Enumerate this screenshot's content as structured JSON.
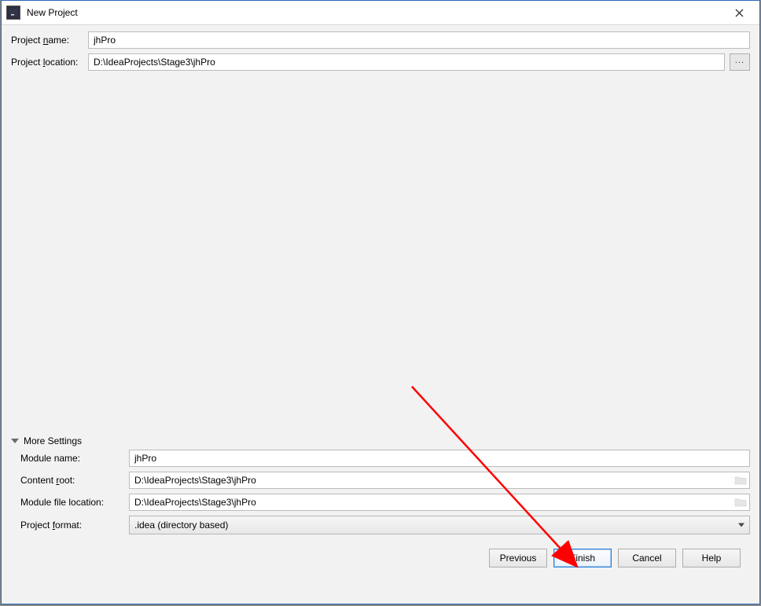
{
  "window": {
    "title": "New Project"
  },
  "project_name": {
    "label_pre": "Project ",
    "label_u": "n",
    "label_post": "ame:",
    "value": "jhPro"
  },
  "project_location": {
    "label_pre": "Project ",
    "label_u": "l",
    "label_post": "ocation:",
    "value": "D:\\IdeaProjects\\Stage3\\jhPro",
    "browse": "..."
  },
  "more_header": "More Settings",
  "module_name": {
    "label": "Module name:",
    "value": "jhPro"
  },
  "content_root": {
    "label_pre": "Content ",
    "label_u": "r",
    "label_post": "oot:",
    "value": "D:\\IdeaProjects\\Stage3\\jhPro"
  },
  "module_file_location": {
    "label": "Module file location:",
    "value": "D:\\IdeaProjects\\Stage3\\jhPro"
  },
  "project_format": {
    "label_pre": "Project ",
    "label_u": "f",
    "label_post": "ormat:",
    "value": ".idea (directory based)"
  },
  "buttons": {
    "previous_u": "P",
    "previous_rest": "revious",
    "finish_u": "F",
    "finish_rest": "inish",
    "cancel": "Cancel",
    "help": "Help"
  }
}
